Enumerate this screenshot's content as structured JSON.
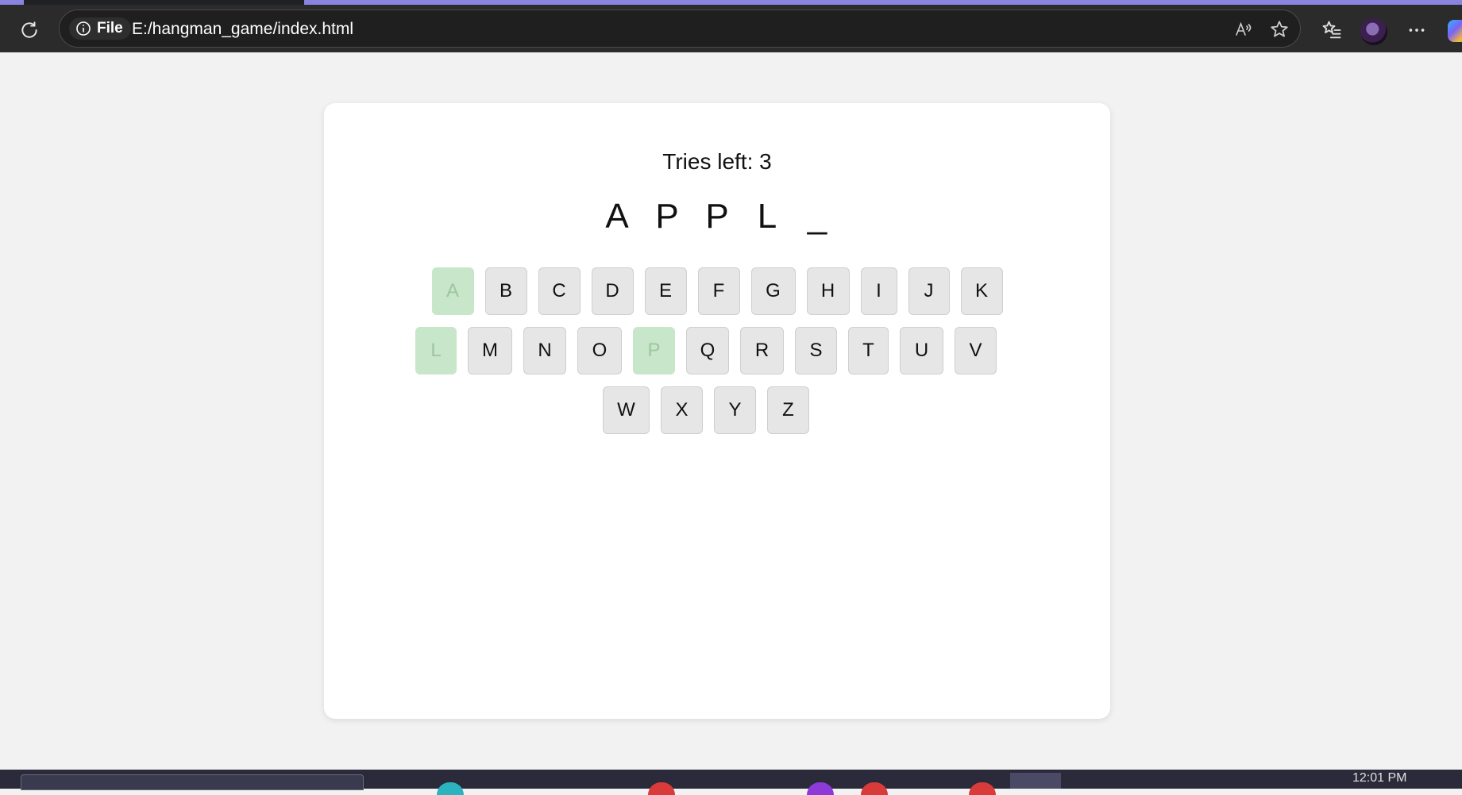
{
  "browser": {
    "site_info_label": "File",
    "url": "E:/hangman_game/index.html"
  },
  "game": {
    "tries_text": "Tries left: 3",
    "word_letters": [
      "A",
      "P",
      "P",
      "L",
      "_"
    ],
    "keyboard_rows": [
      [
        {
          "letter": "A",
          "used": true
        },
        {
          "letter": "B",
          "used": false
        },
        {
          "letter": "C",
          "used": false
        },
        {
          "letter": "D",
          "used": false
        },
        {
          "letter": "E",
          "used": false
        },
        {
          "letter": "F",
          "used": false
        },
        {
          "letter": "G",
          "used": false
        },
        {
          "letter": "H",
          "used": false
        },
        {
          "letter": "I",
          "used": false
        },
        {
          "letter": "J",
          "used": false
        },
        {
          "letter": "K",
          "used": false
        }
      ],
      [
        {
          "letter": "L",
          "used": true
        },
        {
          "letter": "M",
          "used": false
        },
        {
          "letter": "N",
          "used": false
        },
        {
          "letter": "O",
          "used": false
        },
        {
          "letter": "P",
          "used": true
        },
        {
          "letter": "Q",
          "used": false
        },
        {
          "letter": "R",
          "used": false
        },
        {
          "letter": "S",
          "used": false
        },
        {
          "letter": "T",
          "used": false
        },
        {
          "letter": "U",
          "used": false
        },
        {
          "letter": "V",
          "used": false
        }
      ],
      [
        {
          "letter": "W",
          "used": false
        },
        {
          "letter": "X",
          "used": false
        },
        {
          "letter": "Y",
          "used": false
        },
        {
          "letter": "Z",
          "used": false
        }
      ]
    ]
  },
  "taskbar": {
    "clock": "12:01 PM"
  },
  "colors": {
    "page_background": "#f2f2f2",
    "card_background": "#ffffff",
    "key_default": "#e6e6e6",
    "key_used": "#c8e6c9",
    "browser_toolbar": "#2b2b2b"
  },
  "icons": [
    "reload-icon",
    "info-icon",
    "read-aloud-icon",
    "favorite-star-icon",
    "favorites-list-icon",
    "profile-avatar",
    "more-options-icon",
    "copilot-icon"
  ]
}
